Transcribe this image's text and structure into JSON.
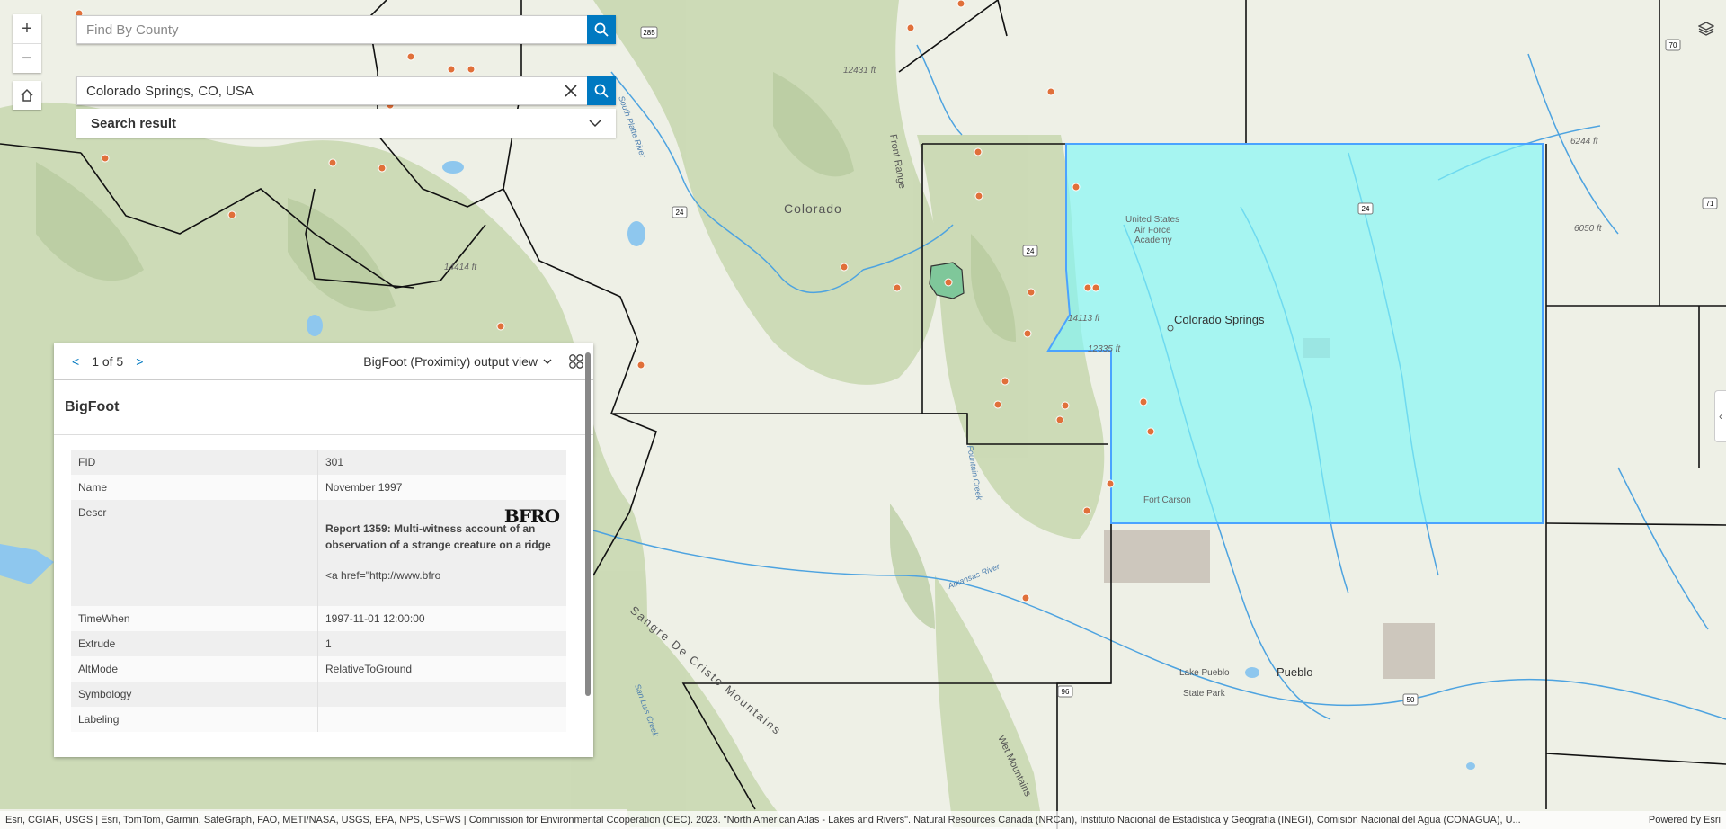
{
  "zoom": {
    "in_glyph": "+",
    "out_glyph": "−"
  },
  "search1": {
    "placeholder": "Find By County",
    "value": ""
  },
  "search2": {
    "value": "Colorado Springs, CO, USA"
  },
  "search_result": {
    "label": "Search result"
  },
  "map_labels": {
    "colorado": "Colorado",
    "colorado_springs": "Colorado Springs",
    "pueblo": "Pueblo",
    "usafa": [
      "United States",
      "Air Force",
      "Academy"
    ],
    "fort_carson": "Fort Carson",
    "lake_pueblo": [
      "Lake Pueblo",
      "State Park"
    ],
    "front_range": "Front Range",
    "sangre": "Sangre De Cristo Mountains",
    "wet_mtns": "Wet Mountains",
    "south_platte": "South Platte River",
    "fountain_creek": "Fountain Creek",
    "arkansas_river": "Arkansas River",
    "san_luis_creek": "San Luis Creek",
    "peaks": [
      "12431 ft",
      "14414 ft",
      "14113 ft",
      "12335 ft",
      "6244 ft",
      "6050 ft"
    ],
    "hwys": [
      "285",
      "24",
      "24",
      "24",
      "96",
      "50",
      "70",
      "71"
    ]
  },
  "popup": {
    "prev": "<",
    "page": "1 of 5",
    "next": ">",
    "view": "BigFoot (Proximity) output view",
    "title": "BigFoot",
    "rows": [
      {
        "key": "FID",
        "value": "301"
      },
      {
        "key": "Name",
        "value": "November 1997"
      },
      {
        "key": "Descr",
        "value": "Report 1359: Multi-witness account of an observation of a strange creature on a ridge",
        "extra": "<a href=\"http://www.bfro"
      },
      {
        "key": "TimeWhen",
        "value": "1997-11-01 12:00:00"
      },
      {
        "key": "Extrude",
        "value": "1"
      },
      {
        "key": "AltMode",
        "value": "RelativeToGround"
      },
      {
        "key": "Symbology",
        "value": ""
      },
      {
        "key": "Labeling",
        "value": ""
      }
    ],
    "logo": "BFRO"
  },
  "footer": {
    "attribution": "Esri, CGIAR, USGS | Esri, TomTom, Garmin, SafeGraph, FAO, METI/NASA, USGS, EPA, NPS, USFWS | Commission for Environmental Cooperation (CEC). 2023. \"North American Atlas - Lakes and Rivers\". Natural Resources Canada (NRCan), Instituto Nacional de Estadística y Geografía (INEGI), Comisión Nacional del Agua (CONAGUA), U...",
    "powered": "Powered by Esri"
  },
  "colors": {
    "accent": "#0079c1",
    "selection_fill": "#7ff7f7",
    "selection_stroke": "#4aa3ff",
    "poi": "#e0703a"
  }
}
